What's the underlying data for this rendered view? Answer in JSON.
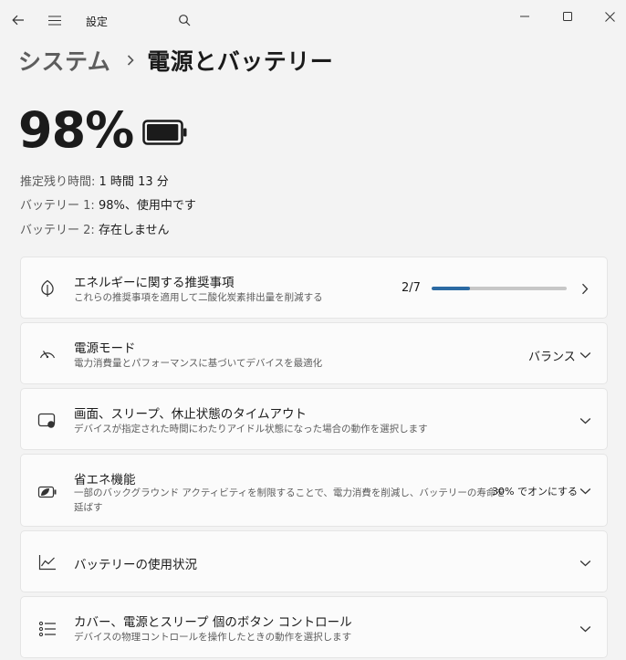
{
  "window": {
    "title": "設定",
    "icons": {
      "back": "back-arrow-icon",
      "menu": "hamburger-menu-icon",
      "search": "search-icon",
      "minimize": "minimize-icon",
      "maximize": "maximize-icon",
      "close": "close-icon"
    }
  },
  "breadcrumb": {
    "parent": "システム",
    "current": "電源とバッテリー"
  },
  "battery": {
    "percent_text": "98%",
    "charge_level": 0.98,
    "remaining_label": "推定残り時間:",
    "remaining_value": "1 時間 13 分",
    "battery1_label": "バッテリー 1:",
    "battery1_value": "98%、使用中です",
    "battery2_label": "バッテリー 2:",
    "battery2_value": "存在しません"
  },
  "cards": {
    "energy": {
      "title": "エネルギーに関する推奨事項",
      "desc": "これらの推奨事項を適用して二酸化炭素排出量を削減する",
      "progress_text": "2/7",
      "progress_fraction": 0.2857,
      "icon": "leaf-icon"
    },
    "power_mode": {
      "title": "電源モード",
      "desc": "電力消費量とパフォーマンスに基づいてデバイスを最適化",
      "value": "バランス",
      "icon": "speedometer-icon"
    },
    "timeout": {
      "title": "画面、スリープ、休止状態のタイムアウト",
      "desc": "デバイスが指定された時間にわたりアイドル状態になった場合の動作を選択します",
      "icon": "screen-sleep-icon"
    },
    "saver": {
      "title": "省エネ機能",
      "desc_line1": "一部のバックグラウンド アクティビティを制限することで、電力消費を削減し、バッテリーの寿命を",
      "desc_line2": "延ばす",
      "value": "30% でオンにする",
      "icon": "battery-saver-icon"
    },
    "usage": {
      "title": "バッテリーの使用状況",
      "icon": "usage-chart-icon"
    },
    "buttons": {
      "title": "カバー、電源とスリープ 個のボタン コントロール",
      "desc": "デバイスの物理コントロールを操作したときの動作を選択します",
      "icon": "button-controls-icon"
    }
  }
}
